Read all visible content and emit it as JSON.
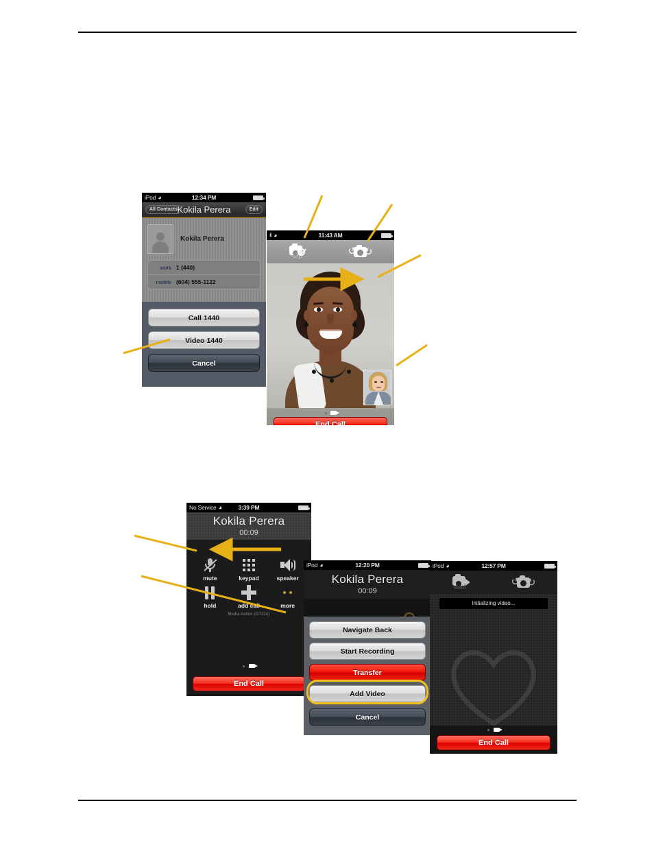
{
  "document": {
    "has_header_rule": true,
    "has_footer_rule": true
  },
  "colors": {
    "callout_arrow": "#E8B017",
    "highlight_ring": "#F2C21A",
    "end_call_red": "#E01B0C",
    "transfer_red": "#E81505"
  },
  "phone_contact": {
    "status": {
      "carrier": "iPod",
      "wifi_icon": "wifi-icon",
      "time": "12:34 PM",
      "battery_icon": "battery-icon"
    },
    "navbar": {
      "back_label": "All Contacts",
      "title": "Kokila Perera",
      "edit_label": "Edit"
    },
    "contact": {
      "avatar_icon": "person-placeholder-icon",
      "name": "Kokila Perera",
      "fields": [
        {
          "label": "work",
          "value": "1 (440)"
        },
        {
          "label": "mobile",
          "value": "(604) 555-1122"
        }
      ]
    },
    "action_sheet": {
      "buttons": [
        {
          "label": "Call 1440",
          "style": "light"
        },
        {
          "label": "Video 1440",
          "style": "light"
        },
        {
          "label": "Cancel",
          "style": "dark"
        }
      ]
    }
  },
  "phone_video": {
    "status": {
      "carrier": "ıll.",
      "wifi_icon": "wifi-icon",
      "time": "11:43 AM",
      "battery_icon": "battery-icon"
    },
    "controls": [
      {
        "icon": "camera-stop-icon",
        "label": "stop"
      },
      {
        "icon": "camera-swap-icon",
        "label": ""
      }
    ],
    "remote_video_alt": "remote party video",
    "self_view_alt": "self view picture-in-picture",
    "page_indicator": {
      "dots": 1,
      "video_icon": "video-camera-icon"
    },
    "end_call_label": "End Call"
  },
  "phone_incall": {
    "status": {
      "carrier": "No Service",
      "wifi_icon": "wifi-icon",
      "time": "3:39 PM",
      "battery_icon": "battery-icon"
    },
    "callee": "Kokila Perera",
    "duration": "00:09",
    "keys": [
      {
        "icon": "mute-microphone-icon",
        "label": "mute"
      },
      {
        "icon": "keypad-icon",
        "label": "keypad"
      },
      {
        "icon": "speaker-icon",
        "label": "speaker"
      },
      {
        "icon": "hold-pause-icon",
        "label": "hold"
      },
      {
        "icon": "add-call-plus-icon",
        "label": "add call"
      },
      {
        "icon": "more-dots-icon",
        "label": "more"
      }
    ],
    "media_status": "Media Active (G711u)",
    "page_indicator": {
      "dots": 1,
      "video_icon": "video-camera-icon"
    },
    "end_call_label": "End Call"
  },
  "phone_sheet": {
    "status": {
      "carrier": "iPod",
      "wifi_icon": "wifi-icon",
      "time": "12:20 PM",
      "battery_icon": "battery-icon"
    },
    "callee": "Kokila Perera",
    "duration": "00:09",
    "buttons": [
      {
        "label": "Navigate Back",
        "style": "light"
      },
      {
        "label": "Start Recording",
        "style": "light"
      },
      {
        "label": "Transfer",
        "style": "red"
      },
      {
        "label": "Add Video",
        "style": "light",
        "highlighted": true
      },
      {
        "label": "Cancel",
        "style": "dark"
      }
    ]
  },
  "phone_init": {
    "status": {
      "carrier": "iPod",
      "wifi_icon": "wifi-icon",
      "time": "12:57 PM",
      "battery_icon": "battery-icon"
    },
    "controls": [
      {
        "icon": "camera-send-icon",
        "label": "send"
      },
      {
        "icon": "camera-swap-icon",
        "label": ""
      }
    ],
    "toast": "initializing video...",
    "page_indicator": {
      "dots": 1,
      "video_icon": "video-camera-icon"
    },
    "end_call_label": "End Call"
  },
  "callouts": [
    {
      "name": "callout-stop-button",
      "target": "phone_video.controls.0"
    },
    {
      "name": "callout-swap-camera-button",
      "target": "phone_video.controls.1"
    },
    {
      "name": "callout-remote-video",
      "target": "phone_video.remote_video_alt"
    },
    {
      "name": "callout-self-view",
      "target": "phone_video.self_view_alt"
    },
    {
      "name": "callout-video-button",
      "target": "phone_contact.action_sheet.buttons.1"
    },
    {
      "name": "callout-call-panel",
      "target": "phone_incall"
    },
    {
      "name": "callout-more-button",
      "target": "phone_incall.keys.5"
    }
  ]
}
